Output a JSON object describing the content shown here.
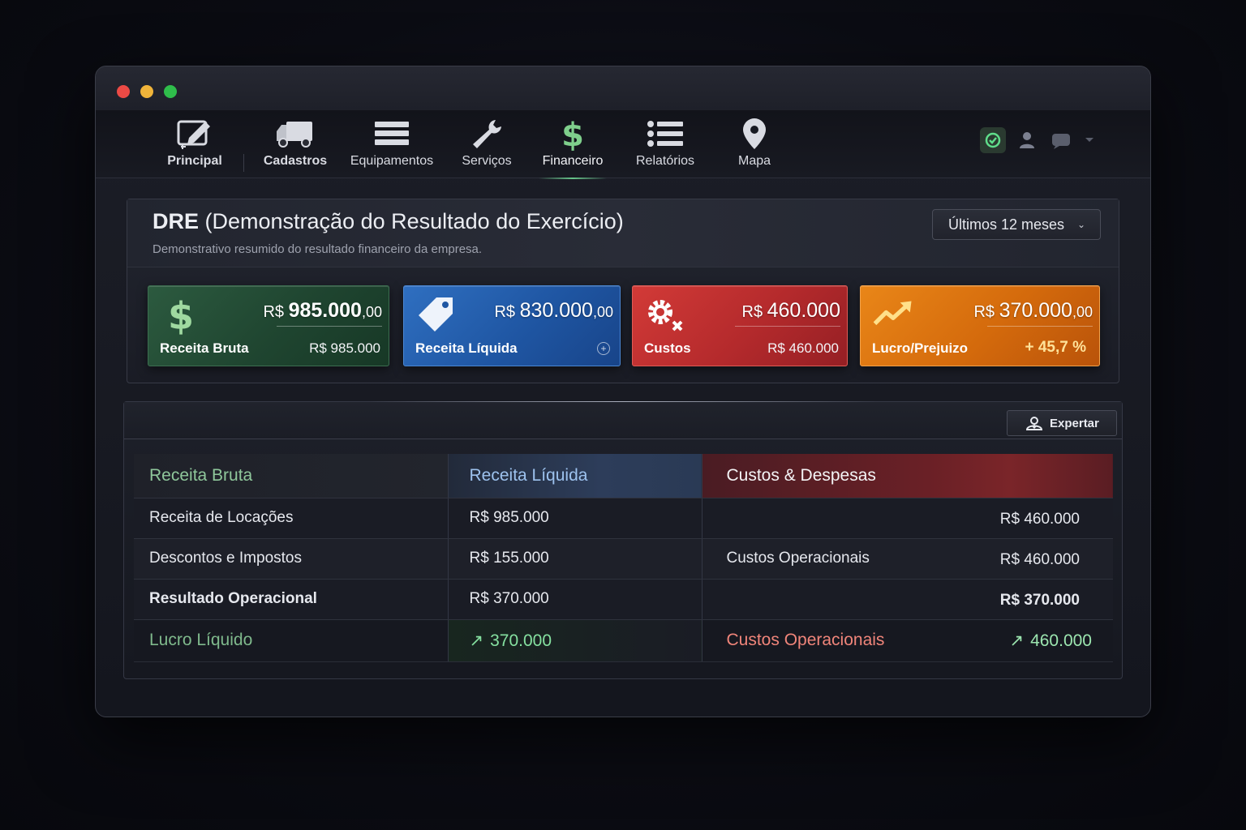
{
  "nav": {
    "items": [
      {
        "label": "Principal",
        "icon": "edit-icon"
      },
      {
        "label": "Cadastros",
        "icon": "truck-icon"
      },
      {
        "label": "Equipamentos",
        "icon": "server-icon"
      },
      {
        "label": "Serviços",
        "icon": "wrench-icon"
      },
      {
        "label": "Financeiro",
        "icon": "dollar-icon"
      },
      {
        "label": "Relatórios",
        "icon": "list-icon"
      },
      {
        "label": "Mapa",
        "icon": "map-pin-icon"
      }
    ],
    "active": "Financeiro"
  },
  "header": {
    "title_bold": "DRE",
    "title_rest": " (Demonstração do Resultado do Exercício)",
    "subtitle": "Demonstrativo resumido do resultado financeiro da empresa.",
    "period": "Últimos 12 meses"
  },
  "cards": {
    "receita_bruta": {
      "currency": "R$ ",
      "amount": "985.000",
      "cents": ",00",
      "label": "Receita Bruta",
      "sub": "R$ 985.000",
      "color": "#1f4530"
    },
    "receita_liquida": {
      "currency": "R$ ",
      "amount": "830.000",
      "cents": ",00",
      "label": "Receita Líquida",
      "color": "#1f56a3"
    },
    "custos": {
      "currency": "R$ ",
      "amount": "460.000",
      "label": "Custos",
      "sub": "R$ 460.000",
      "color": "#b42a2c"
    },
    "lucro": {
      "currency": "R$ ",
      "amount": "370.000",
      "cents": ",00",
      "label": "Lucro/Prejuizo",
      "sub": "+ 45,7 %",
      "color": "#d46a0c"
    }
  },
  "table": {
    "export_label": "Expertar",
    "headers": [
      "Receita Bruta",
      "Receita Líquida",
      "Custos & Despesas"
    ],
    "rows": [
      {
        "label": "Receita de Locações",
        "value": "R$ 985.000",
        "cost_label": "",
        "cost_value": "R$ 460.000"
      },
      {
        "label": "Descontos e Impostos",
        "value": "R$ 155.000",
        "cost_label": "Custos Operacionais",
        "cost_value": "R$ 460.000"
      },
      {
        "label": "Resultado Operacional",
        "value": "R$ 370.000",
        "cost_label": "",
        "cost_value": "R$ 370.000"
      }
    ],
    "final": {
      "label": "Lucro Líquido",
      "value": "370.000",
      "cost_label": "Custos Operacionais",
      "cost_value": "460.000"
    }
  },
  "colors": {
    "accent_green": "#67c48a",
    "negative": "#f0857a"
  }
}
